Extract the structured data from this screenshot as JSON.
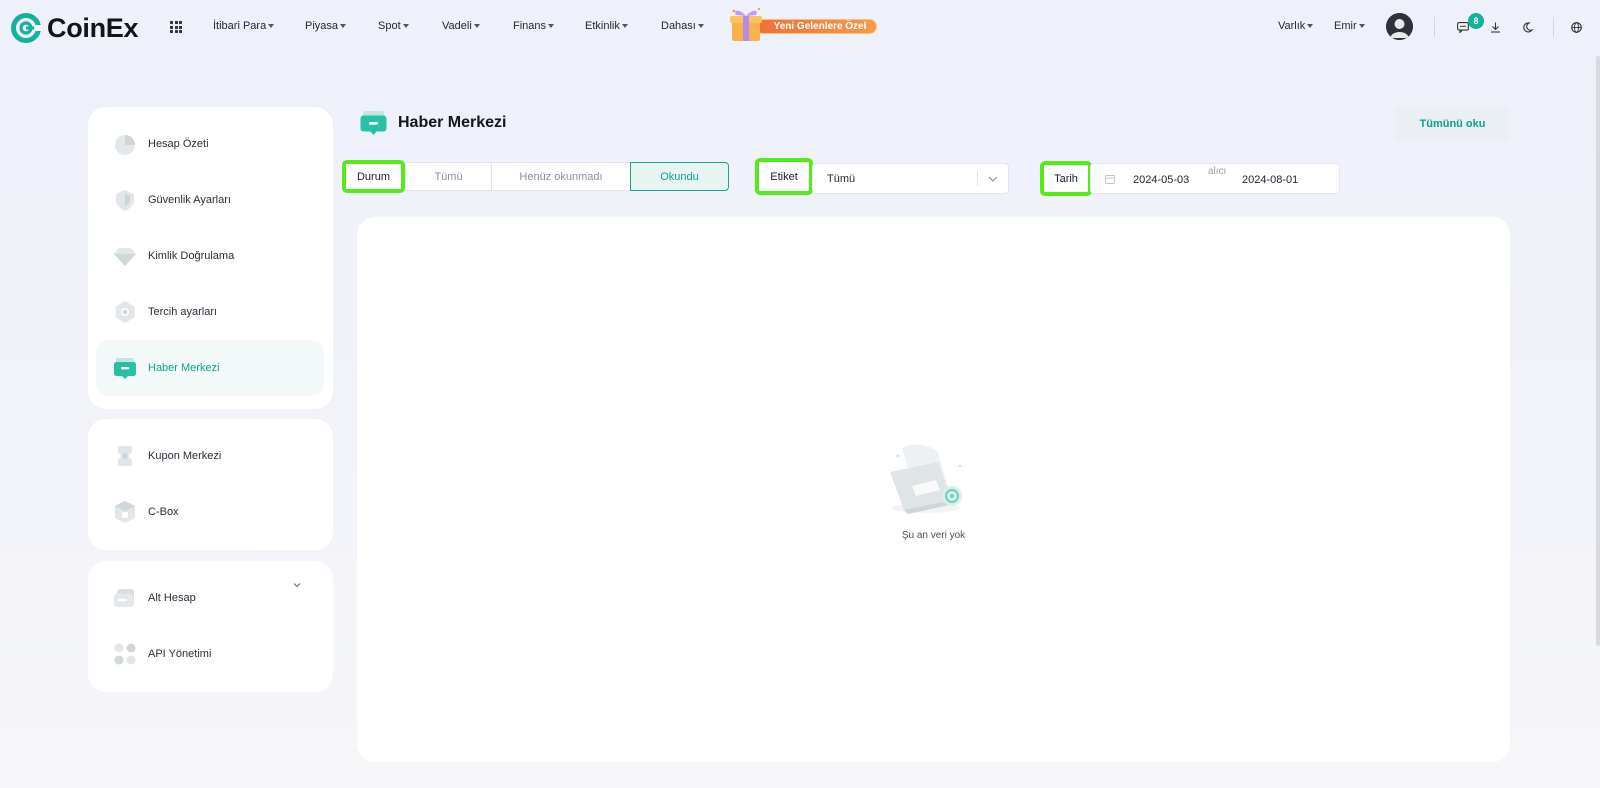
{
  "brand": {
    "name": "CoinEx",
    "accent": "#13b09a"
  },
  "nav": {
    "items": [
      {
        "label": "İtibari Para"
      },
      {
        "label": "Piyasa"
      },
      {
        "label": "Spot"
      },
      {
        "label": "Vadeli"
      },
      {
        "label": "Finans"
      },
      {
        "label": "Etkinlik"
      },
      {
        "label": "Dahası"
      }
    ],
    "promo": "Yeni Gelenlere Özel",
    "asset_label": "Varlık",
    "order_label": "Emir",
    "notification_count": "8"
  },
  "sidebar": {
    "groups": [
      {
        "items": [
          {
            "label": "Hesap Özeti",
            "icon": "pie-chart-icon"
          },
          {
            "label": "Güvenlik Ayarları",
            "icon": "shield-icon"
          },
          {
            "label": "Kimlik Doğrulama",
            "icon": "diamond-icon"
          },
          {
            "label": "Tercih ayarları",
            "icon": "hexagon-settings-icon"
          },
          {
            "label": "Haber Merkezi",
            "icon": "message-box-icon",
            "active": true
          }
        ]
      },
      {
        "items": [
          {
            "label": "Kupon Merkezi",
            "icon": "coupon-icon"
          },
          {
            "label": "C-Box",
            "icon": "box-icon"
          }
        ]
      },
      {
        "items": [
          {
            "label": "Alt Hesap",
            "icon": "sub-account-icon"
          },
          {
            "label": "API Yönetimi",
            "icon": "api-icon"
          }
        ]
      }
    ]
  },
  "main": {
    "title": "Haber Merkezi",
    "read_all": "Tümünü oku",
    "filters": {
      "status_label": "Durum",
      "status_options": [
        "Tümü",
        "Henüz okunmadı",
        "Okundu"
      ],
      "status_selected": "Okundu",
      "tag_label": "Etiket",
      "tag_value": "Tümü",
      "date_label": "Tarih",
      "date_start": "2024-05-03",
      "date_separator": "alıcı",
      "date_end": "2024-08-01"
    },
    "empty_text": "Şu an veri yok"
  }
}
